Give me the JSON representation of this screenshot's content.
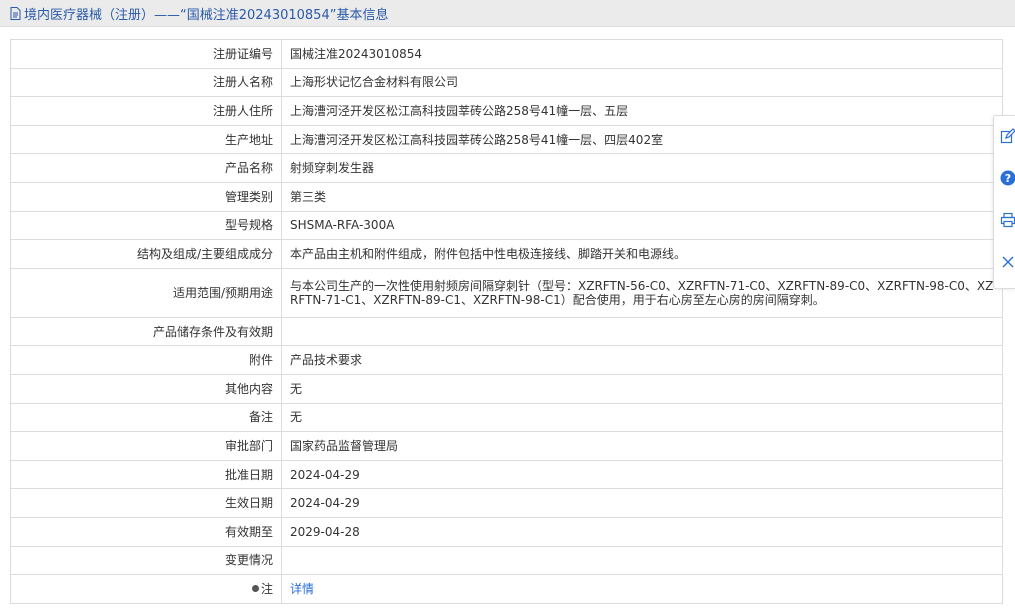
{
  "header": {
    "title": "境内医疗器械（注册）——“国械注准20243010854”基本信息"
  },
  "rows": [
    {
      "label": "注册证编号",
      "value": "国械注准20243010854"
    },
    {
      "label": "注册人名称",
      "value": "上海形状记忆合金材料有限公司"
    },
    {
      "label": "注册人住所",
      "value": "上海漕河泾开发区松江高科技园莘砖公路258号41幢一层、五层"
    },
    {
      "label": "生产地址",
      "value": "上海漕河泾开发区松江高科技园莘砖公路258号41幢一层、四层402室"
    },
    {
      "label": "产品名称",
      "value": "射频穿刺发生器"
    },
    {
      "label": "管理类别",
      "value": "第三类"
    },
    {
      "label": "型号规格",
      "value": "SHSMA-RFA-300A"
    },
    {
      "label": "结构及组成/主要组成成分",
      "value": "本产品由主机和附件组成，附件包括中性电极连接线、脚踏开关和电源线。"
    },
    {
      "label": "适用范围/预期用途",
      "value": "与本公司生产的一次性使用射频房间隔穿刺针（型号：XZRFTN-56-C0、XZRFTN-71-C0、XZRFTN-89-C0、XZRFTN-98-C0、XZRFTN-71-C1、XZRFTN-89-C1、XZRFTN-98-C1）配合使用，用于右心房至左心房的房间隔穿刺。"
    },
    {
      "label": "产品储存条件及有效期",
      "value": ""
    },
    {
      "label": "附件",
      "value": "产品技术要求"
    },
    {
      "label": "其他内容",
      "value": "无"
    },
    {
      "label": "备注",
      "value": "无"
    },
    {
      "label": "审批部门",
      "value": "国家药品监督管理局"
    },
    {
      "label": "批准日期",
      "value": "2024-04-29"
    },
    {
      "label": "生效日期",
      "value": "2024-04-29"
    },
    {
      "label": "有效期至",
      "value": "2029-04-28"
    },
    {
      "label": "变更情况",
      "value": ""
    }
  ],
  "note_row": {
    "label": "注",
    "link_text": "详情"
  },
  "side_toolbar": {
    "icons": [
      "edit-icon",
      "help-icon",
      "print-icon",
      "close-icon"
    ],
    "accent": "#2a6fd6"
  },
  "colors": {
    "title": "#2a5aa8",
    "link": "#2a6fd6",
    "border": "#dcdcdc",
    "header_bg": "#ebebeb"
  }
}
